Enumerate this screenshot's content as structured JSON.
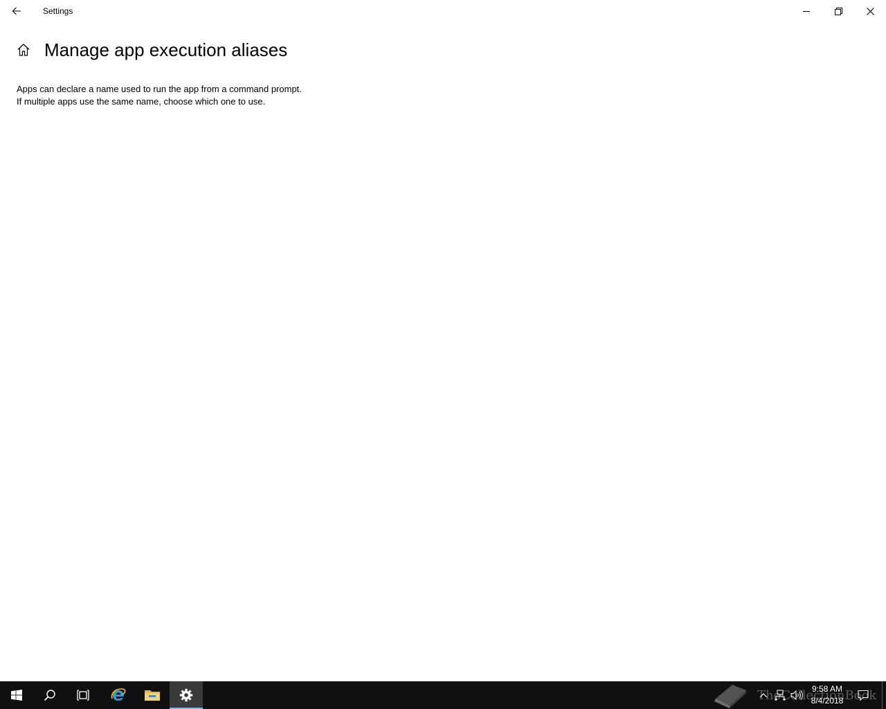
{
  "window": {
    "title": "Settings"
  },
  "page": {
    "title": "Manage app execution aliases",
    "description_line1": "Apps can declare a name used to run the app from a command prompt.",
    "description_line2": "If multiple apps use the same name, choose which one to use."
  },
  "icons": {
    "back": "arrow-left-icon",
    "minimize": "minimize-icon",
    "maximize": "restore-icon",
    "close": "close-icon",
    "home": "home-icon",
    "start": "windows-logo-icon",
    "search": "search-icon",
    "task_view": "task-view-icon",
    "edge": "internet-explorer-icon",
    "explorer": "folder-icon",
    "settings": "gear-icon",
    "tray_chevron": "chevron-up-icon",
    "network": "network-icon",
    "volume": "volume-icon",
    "action_center": "notification-icon"
  },
  "taskbar": {
    "clock_time": "9:58 AM",
    "clock_date": "8/4/2018",
    "watermark": "TheCollectionBook"
  },
  "colors": {
    "taskbar_bg": "#101010",
    "active_indicator": "#76b9ed",
    "accent": "#0078d7"
  }
}
